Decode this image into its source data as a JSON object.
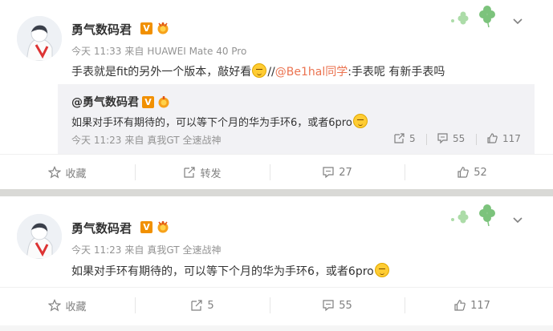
{
  "post1": {
    "username": "勇气数码君",
    "badge_v": "V",
    "time": "今天 11:33",
    "source_prefix": "来自",
    "source": "HUAWEI Mate 40 Pro",
    "text_before": "手表就是fit的另外一个版本，敲好看",
    "text_slashes": "//",
    "mention": "@Be1hal同学",
    "text_after": ":手表呢  有新手表吗",
    "repost": {
      "author": "@勇气数码君",
      "badge_v": "V",
      "text": "如果对手环有期待的，可以等下个月的华为手环6，或者6pro",
      "time": "今天 11:23",
      "source_prefix": "来自",
      "source": "真我GT 全速战神",
      "reposts": "5",
      "comments": "55",
      "likes": "117"
    },
    "actions": {
      "favorite": "收藏",
      "repost": "转发",
      "comments": "27",
      "likes": "52"
    }
  },
  "post2": {
    "username": "勇气数码君",
    "badge_v": "V",
    "time": "今天 11:23",
    "source_prefix": "来自",
    "source": "真我GT 全速战神",
    "text": "如果对手环有期待的，可以等下个月的华为手环6，或者6pro",
    "actions": {
      "favorite": "收藏",
      "reposts": "5",
      "comments": "55",
      "likes": "117"
    }
  },
  "colors": {
    "link": "#eb7350",
    "v_badge": "#f19000",
    "clover": "#7cc37c",
    "muted": "#939393"
  },
  "icons": [
    "avatar",
    "v-badge-icon",
    "medal-icon",
    "clover-decoration-icon",
    "chevron-down-icon",
    "star-icon",
    "share-icon",
    "comment-icon",
    "thumbs-up-icon",
    "emoji-icon"
  ]
}
